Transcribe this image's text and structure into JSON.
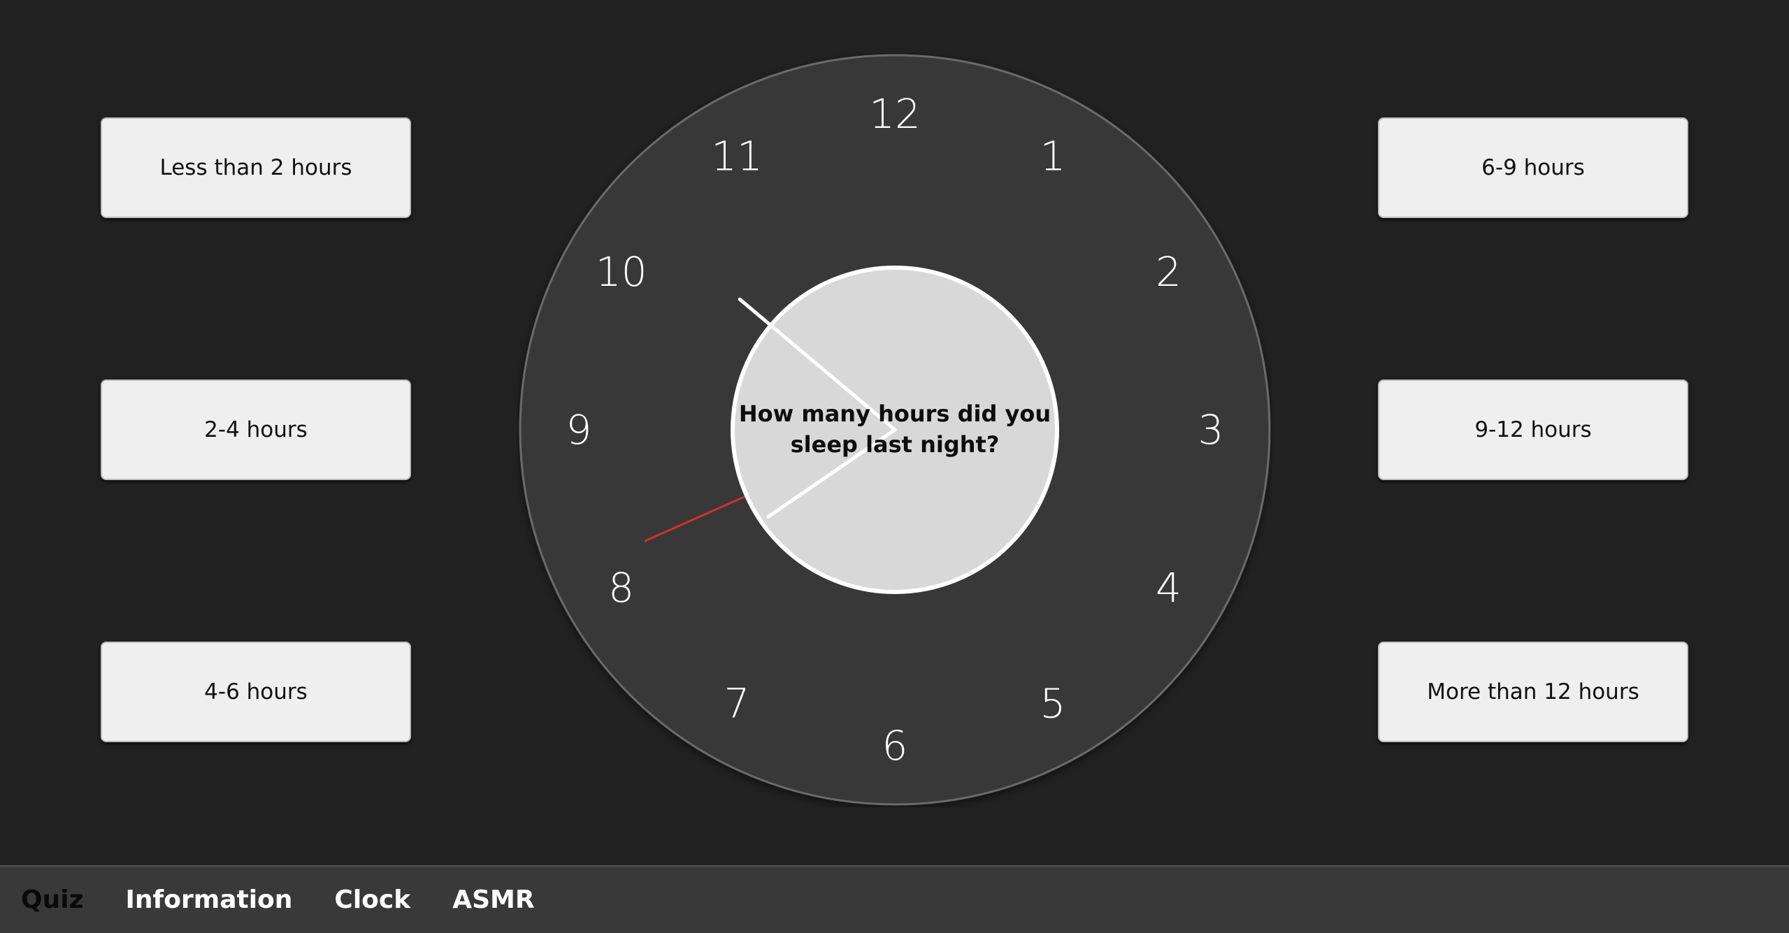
{
  "quiz": {
    "question": "How many hours did you sleep last night?",
    "answers_left": [
      "Less than 2 hours",
      "2-4 hours",
      "4-6 hours"
    ],
    "answers_right": [
      "6-9 hours",
      "9-12 hours",
      "More than 12 hours"
    ]
  },
  "clock": {
    "numerals": [
      "12",
      "1",
      "2",
      "3",
      "4",
      "5",
      "6",
      "7",
      "8",
      "9",
      "10",
      "11"
    ],
    "time": {
      "hour": 7,
      "minute": 51,
      "second": 41
    },
    "second_hand_color": "#d32f2f"
  },
  "navbar": {
    "items": [
      "Quiz",
      "Information",
      "Clock",
      "ASMR"
    ],
    "active": "Quiz"
  },
  "colors": {
    "background": "#212121",
    "clock_face": "#393939",
    "center_disc": "#d8d8d8",
    "button_bg": "#efefef",
    "nav_bg": "#393939"
  }
}
